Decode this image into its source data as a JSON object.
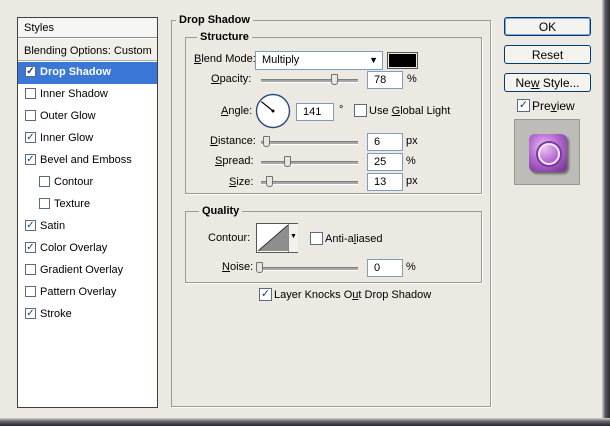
{
  "styles_panel": {
    "header": "Styles",
    "blending_options": "Blending Options: Custom",
    "items": [
      {
        "label": "Drop Shadow",
        "checked": true,
        "selected": true
      },
      {
        "label": "Inner Shadow",
        "checked": false
      },
      {
        "label": "Outer Glow",
        "checked": false
      },
      {
        "label": "Inner Glow",
        "checked": true
      },
      {
        "label": "Bevel and Emboss",
        "checked": true
      },
      {
        "label": "Contour",
        "checked": false
      },
      {
        "label": "Texture",
        "checked": false
      },
      {
        "label": "Satin",
        "checked": true
      },
      {
        "label": "Color Overlay",
        "checked": true
      },
      {
        "label": "Gradient Overlay",
        "checked": false
      },
      {
        "label": "Pattern Overlay",
        "checked": false
      },
      {
        "label": "Stroke",
        "checked": true
      }
    ]
  },
  "drop_shadow": {
    "title": "Drop Shadow",
    "structure": {
      "title": "Structure",
      "blend_mode": {
        "label": "Blend Mode:",
        "value": "Multiply",
        "color": "#000000"
      },
      "opacity": {
        "label": "Opacity:",
        "value": "78",
        "unit": "%",
        "level": 0.78
      },
      "angle": {
        "label": "Angle:",
        "value": "141",
        "unit": "°",
        "degrees": 141
      },
      "use_global_light": {
        "label": "Use Global Light",
        "checked": false
      },
      "distance": {
        "label": "Distance:",
        "value": "6",
        "unit": "px",
        "level": 0.02
      },
      "spread": {
        "label": "Spread:",
        "value": "25",
        "unit": "%",
        "level": 0.25
      },
      "size": {
        "label": "Size:",
        "value": "13",
        "unit": "px",
        "level": 0.05
      }
    },
    "quality": {
      "title": "Quality",
      "contour_label": "Contour:",
      "anti_aliased": {
        "label": "Anti-aliased",
        "checked": false
      },
      "noise": {
        "label": "Noise:",
        "value": "0",
        "unit": "%",
        "level": 0
      }
    },
    "layer_knocks_out": {
      "label": "Layer Knocks Out Drop Shadow",
      "checked": true
    }
  },
  "buttons": {
    "ok": "OK",
    "reset": "Reset",
    "new_style": "New Style..."
  },
  "preview": {
    "label": "Preview",
    "checked": true
  }
}
